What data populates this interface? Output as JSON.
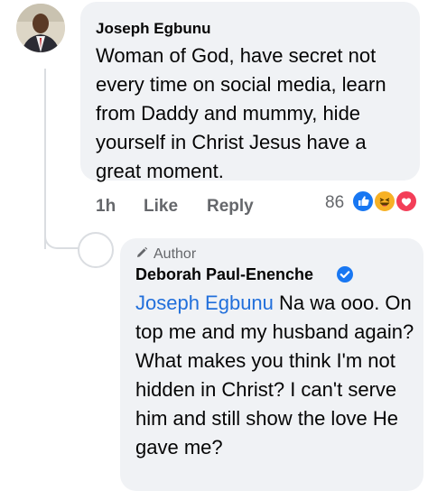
{
  "comment": {
    "author": "Joseph Egbunu",
    "text": "Woman of God, have secret not every time on social media, learn from Daddy and mummy, hide yourself in Christ Jesus have a great moment.",
    "time": "1h",
    "like_label": "Like",
    "reply_label": "Reply",
    "reaction_count": "86",
    "reactions": [
      "like-icon",
      "haha-icon",
      "love-icon"
    ]
  },
  "reply": {
    "badge": "Author",
    "author": "Deborah Paul-Enenche",
    "verified_icon": "verified-badge-icon",
    "mention": "Joseph Egbunu",
    "text": " Na wa ooo. On top me and my husband again? What makes you think I'm not hidden in Christ? I can't serve him and still show the love He gave me?"
  },
  "colors": {
    "bubble": "#f0f2f5",
    "secondary_text": "#65676b",
    "mention": "#216fdb",
    "like_blue": "#1877f2",
    "love_red": "#f33e58",
    "haha_yellow": "#f7b125"
  }
}
